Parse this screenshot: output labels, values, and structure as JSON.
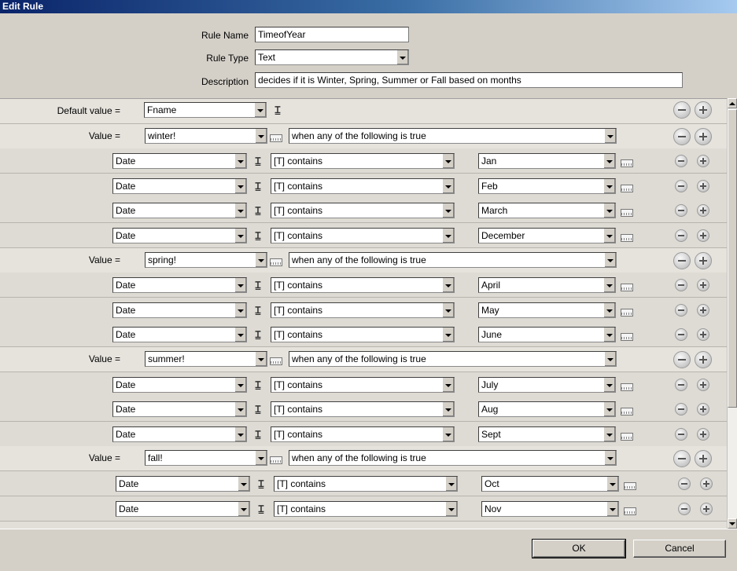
{
  "window": {
    "title": "Edit Rule"
  },
  "header": {
    "rule_name_label": "Rule Name",
    "rule_name_value": "TimeofYear",
    "rule_type_label": "Rule Type",
    "rule_type_value": "Text",
    "description_label": "Description",
    "description_value": "decides if it is Winter, Spring, Summer or Fall based on months"
  },
  "default_row": {
    "label": "Default value =",
    "value": "Fname"
  },
  "value_label": "Value =",
  "groups": [
    {
      "value": "winter!",
      "condition": "when any of the following is true",
      "rules": [
        {
          "field": "Date",
          "op": "[T] contains",
          "value": "Jan"
        },
        {
          "field": "Date",
          "op": "[T] contains",
          "value": "Feb"
        },
        {
          "field": "Date",
          "op": "[T] contains",
          "value": "March"
        },
        {
          "field": "Date",
          "op": "[T] contains",
          "value": "December"
        }
      ]
    },
    {
      "value": "spring!",
      "condition": "when any of the following is true",
      "rules": [
        {
          "field": "Date",
          "op": "[T] contains",
          "value": "April"
        },
        {
          "field": "Date",
          "op": "[T] contains",
          "value": "May"
        },
        {
          "field": "Date",
          "op": "[T] contains",
          "value": "June"
        }
      ]
    },
    {
      "value": "summer!",
      "condition": "when any of the following is true",
      "rules": [
        {
          "field": "Date",
          "op": "[T] contains",
          "value": "July"
        },
        {
          "field": "Date",
          "op": "[T] contains",
          "value": "Aug"
        },
        {
          "field": "Date",
          "op": "[T] contains",
          "value": "Sept"
        }
      ]
    },
    {
      "value": "fall!",
      "condition": "when any of the following is true",
      "rules": [
        {
          "field": "Date",
          "op": "[T] contains",
          "value": "Oct"
        },
        {
          "field": "Date",
          "op": "[T] contains",
          "value": "Nov"
        }
      ]
    }
  ],
  "footer": {
    "ok_label": "OK",
    "cancel_label": "Cancel"
  }
}
